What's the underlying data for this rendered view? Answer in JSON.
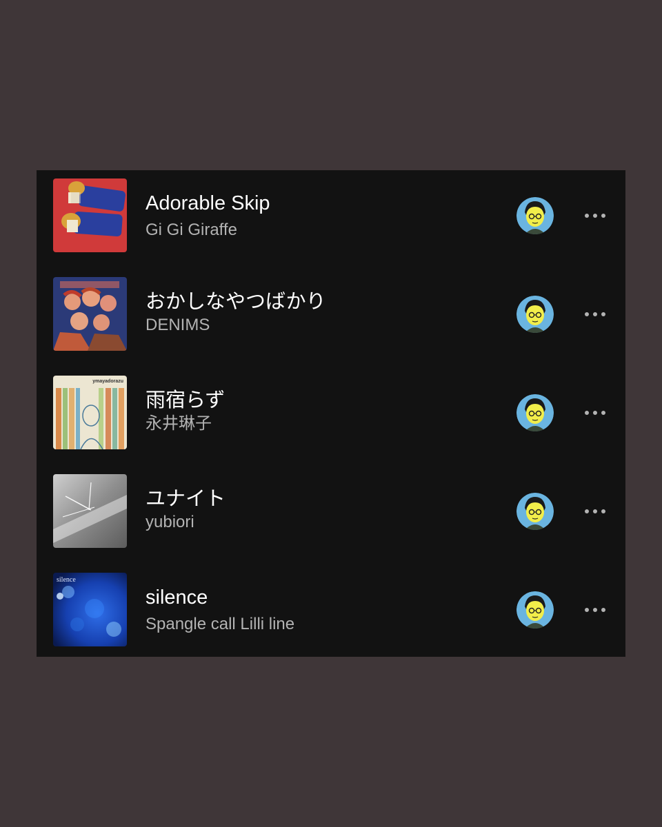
{
  "tracks": [
    {
      "title": "Adorable Skip",
      "artist": "Gi Gi Giraffe",
      "cover_icon": "album-cover-adorable-skip",
      "avatar_icon": "user-avatar-icon",
      "more_icon": "more-options-icon"
    },
    {
      "title": "おかしなやつばかり",
      "artist": "DENIMS",
      "cover_icon": "album-cover-okashinayatsubakari",
      "avatar_icon": "user-avatar-icon",
      "more_icon": "more-options-icon"
    },
    {
      "title": "雨宿らず",
      "artist": "永井琳子",
      "cover_icon": "album-cover-amayadorazu",
      "avatar_icon": "user-avatar-icon",
      "more_icon": "more-options-icon"
    },
    {
      "title": "ユナイト",
      "artist": "yubiori",
      "cover_icon": "album-cover-unite",
      "avatar_icon": "user-avatar-icon",
      "more_icon": "more-options-icon"
    },
    {
      "title": "silence",
      "artist": "Spangle call Lilli line",
      "cover_icon": "album-cover-silence",
      "avatar_icon": "user-avatar-icon",
      "more_icon": "more-options-icon"
    }
  ],
  "cover_text": {
    "amayadorazu": "ymayadorazu",
    "silence": "silence"
  },
  "colors": {
    "background": "#3f3638",
    "panel": "#121212",
    "title": "#ffffff",
    "artist": "#b3b3b3",
    "more_dots": "#b3b3b3",
    "avatar_bg": "#6ab4e0",
    "avatar_face": "#f2ee4a"
  }
}
